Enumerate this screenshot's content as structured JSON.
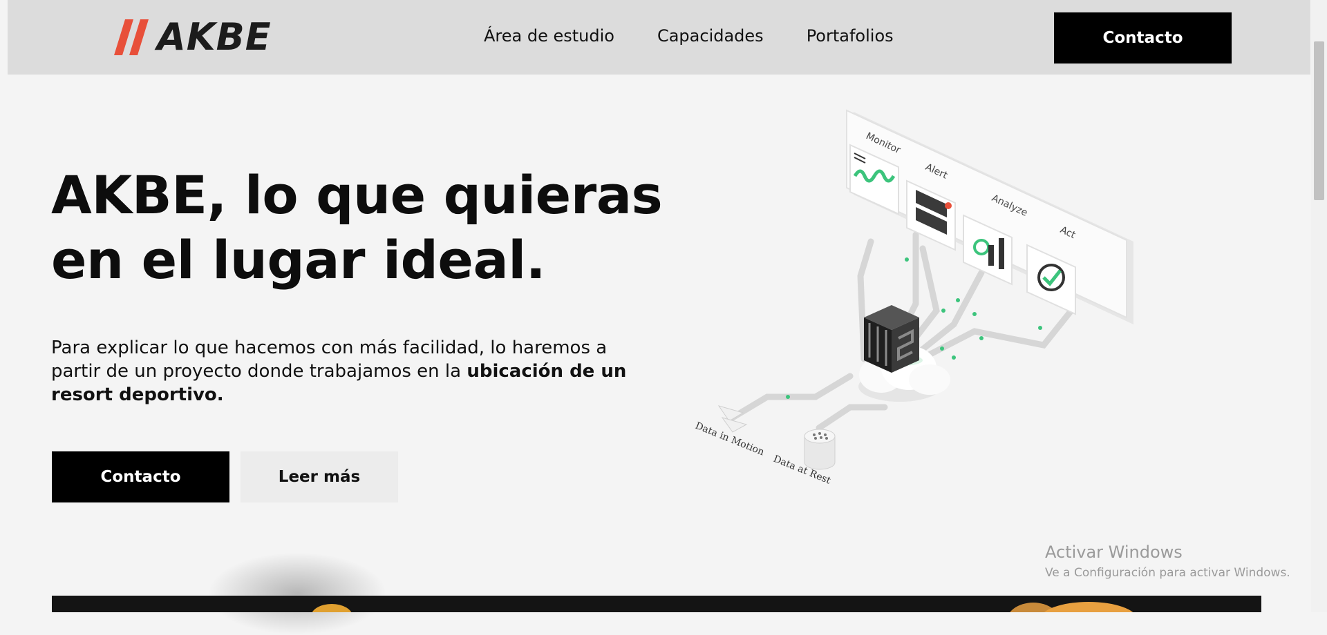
{
  "header": {
    "logo_text": "AKBE",
    "nav": [
      "Área de estudio",
      "Capacidades",
      "Portafolios"
    ],
    "contact_label": "Contacto"
  },
  "hero": {
    "title": "AKBE, lo que quieras en el lugar ideal.",
    "text_plain": "Para explicar lo que hacemos con más facilidad, lo haremos a partir de un proyecto donde trabajamos en la ",
    "text_bold": "ubicación de un resort deportivo.",
    "primary_button": "Contacto",
    "secondary_button": "Leer más"
  },
  "illustration": {
    "labels": [
      "Monitor",
      "Alert",
      "Analyze",
      "Act",
      "Data in Motion",
      "Data at Rest"
    ]
  },
  "watermark": {
    "title": "Activar Windows",
    "subtitle": "Ve a Configuración para activar Windows."
  },
  "colors": {
    "accent_red": "#e8503a",
    "accent_green": "#3cc47c",
    "header_bg": "#dcdcdc",
    "page_bg": "#f4f4f4",
    "button_dark": "#000000"
  }
}
